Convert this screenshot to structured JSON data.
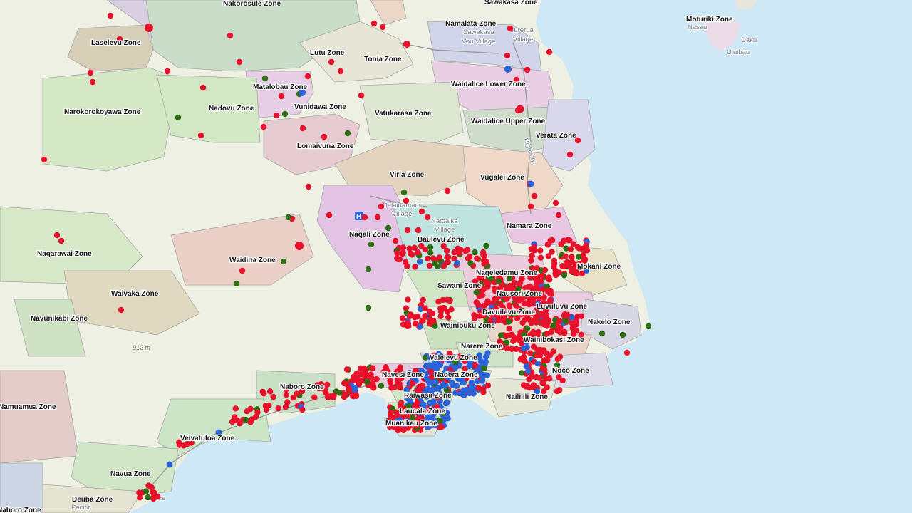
{
  "map": {
    "colors": {
      "sea": "#cfe8f6",
      "land": "#eef0e4",
      "red_point": "#e8112b",
      "blue_point": "#2b63d8",
      "green_point": "#2f6e12"
    },
    "zones": [
      {
        "name": "Nakorosule Zone"
      },
      {
        "name": "Sawakasa Zone"
      },
      {
        "name": "Namalata Zone"
      },
      {
        "name": "Moturiki Zone"
      },
      {
        "name": "Laselevu Zone"
      },
      {
        "name": "Lutu Zone"
      },
      {
        "name": "Tonia Zone"
      },
      {
        "name": "Matalobau Zone"
      },
      {
        "name": "Waidalice Lower Zone"
      },
      {
        "name": "Narokorokoyawa Zone"
      },
      {
        "name": "Nadovu Zone"
      },
      {
        "name": "Vunidawa Zone"
      },
      {
        "name": "Vatukarasa Zone"
      },
      {
        "name": "Waidalice Upper Zone"
      },
      {
        "name": "Verata Zone"
      },
      {
        "name": "Lomaivuna Zone"
      },
      {
        "name": "Viria Zone"
      },
      {
        "name": "Vugalei Zone"
      },
      {
        "name": "Namara Zone"
      },
      {
        "name": "Naqali Zone"
      },
      {
        "name": "Baulevu Zone"
      },
      {
        "name": "Naqarawai Zone"
      },
      {
        "name": "Waidina Zone"
      },
      {
        "name": "Naqeledamu Zone"
      },
      {
        "name": "Mokani Zone"
      },
      {
        "name": "Sawani Zone"
      },
      {
        "name": "Nausori Zone"
      },
      {
        "name": "Waivaka Zone"
      },
      {
        "name": "Luvuluvu Zone"
      },
      {
        "name": "Davuilevu Zone"
      },
      {
        "name": "Navunikabi Zone"
      },
      {
        "name": "Nakelo Zone"
      },
      {
        "name": "Wainibuku Zone"
      },
      {
        "name": "Wainibokasi Zone"
      },
      {
        "name": "Narere Zone"
      },
      {
        "name": "Valelevu Zone"
      },
      {
        "name": "Noco Zone"
      },
      {
        "name": "Navesi Zone"
      },
      {
        "name": "Nadera Zone"
      },
      {
        "name": "Naboro Zone"
      },
      {
        "name": "Raiwasa Zone"
      },
      {
        "name": "Naililili Zone"
      },
      {
        "name": "Namuamua Zone"
      },
      {
        "name": "Laucala Zone"
      },
      {
        "name": "Muanikau Zone"
      },
      {
        "name": "Veivatuloa Zone"
      },
      {
        "name": "Navua Zone"
      },
      {
        "name": "Deuba Zone"
      },
      {
        "name": "Naboro Zone"
      }
    ],
    "place_labels": [
      "Sawakasa",
      "Vou Village",
      "Burerua",
      "Village",
      "Nasau",
      "Daku",
      "Uluibau",
      "Delaidamanu",
      "Village",
      "Natoaika",
      "Village",
      "Pacific",
      "Navua",
      "Highway"
    ],
    "elevation_label": "912 m",
    "hospital_symbol": "H"
  }
}
